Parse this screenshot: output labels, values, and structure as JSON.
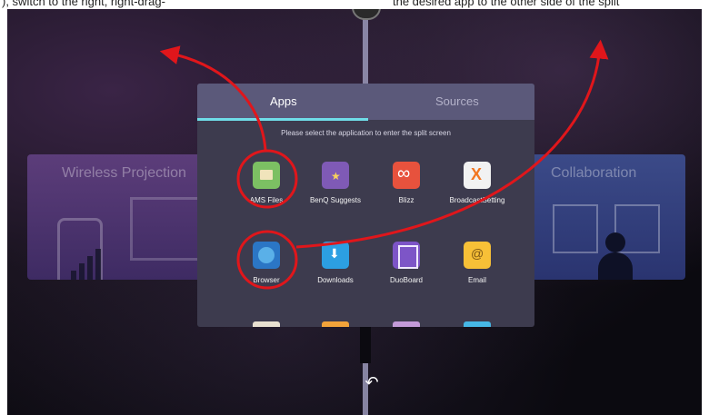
{
  "top_fragment": {
    "left": "), switch to the right, right-drag-",
    "right": "the desired app to the other side of the split"
  },
  "background_cards": {
    "left_title": "Wireless Projection",
    "right_title": "Collaboration"
  },
  "panel": {
    "tabs": [
      {
        "label": "Apps",
        "active": true
      },
      {
        "label": "Sources",
        "active": false
      }
    ],
    "prompt": "Please select the application to enter the split screen",
    "apps": [
      {
        "label": "AMS Files",
        "icon": "ams-files-icon",
        "highlighted": true
      },
      {
        "label": "BenQ Suggests",
        "icon": "benq-suggests-icon",
        "highlighted": false
      },
      {
        "label": "Blizz",
        "icon": "blizz-icon",
        "highlighted": false
      },
      {
        "label": "BroadcastSetting",
        "icon": "broadcast-setting-icon",
        "highlighted": false
      },
      {
        "label": "Browser",
        "icon": "browser-icon",
        "highlighted": true
      },
      {
        "label": "Downloads",
        "icon": "downloads-icon",
        "highlighted": false
      },
      {
        "label": "DuoBoard",
        "icon": "duoboard-icon",
        "highlighted": false
      },
      {
        "label": "Email",
        "icon": "email-icon",
        "highlighted": false
      }
    ]
  },
  "colors": {
    "accent": "#6fdde8",
    "annotation": "#e0161b",
    "panel_bg": "#3d3b4e",
    "tab_bg": "#5b597a"
  },
  "back_icon": "back-arrow-icon"
}
